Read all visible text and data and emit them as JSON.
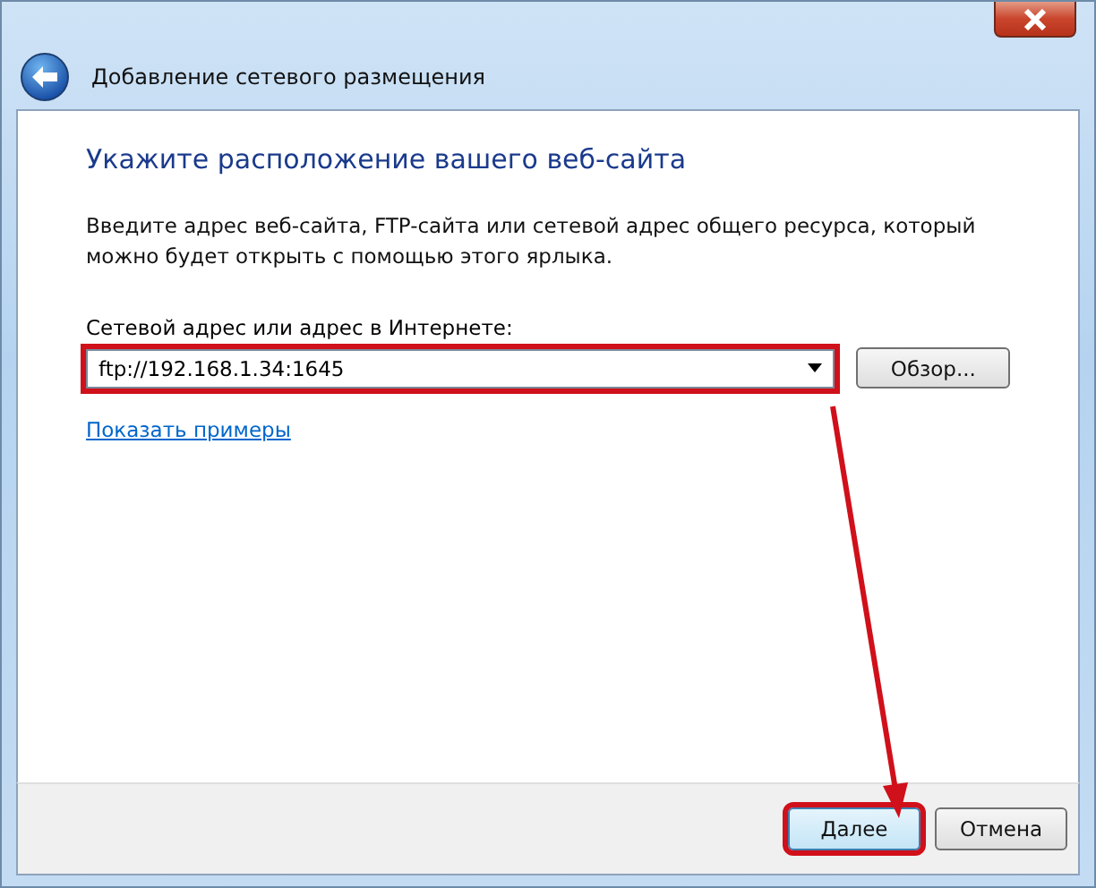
{
  "window": {
    "title": "Добавление сетевого размещения"
  },
  "heading": "Укажите расположение вашего веб-сайта",
  "description": "Введите адрес веб-сайта, FTP-сайта или сетевой адрес общего ресурса, который можно будет открыть с помощью этого ярлыка.",
  "address_field": {
    "label": "Сетевой адрес или адрес в Интернете:",
    "value": "ftp://192.168.1.34:1645",
    "highlighted": true
  },
  "browse_button": {
    "label": "Обзор...",
    "highlighted": false
  },
  "examples_link": "Показать примеры",
  "buttons": [
    {
      "label": "Далее",
      "highlighted": true
    },
    {
      "label": "Отмена",
      "highlighted": false
    }
  ]
}
